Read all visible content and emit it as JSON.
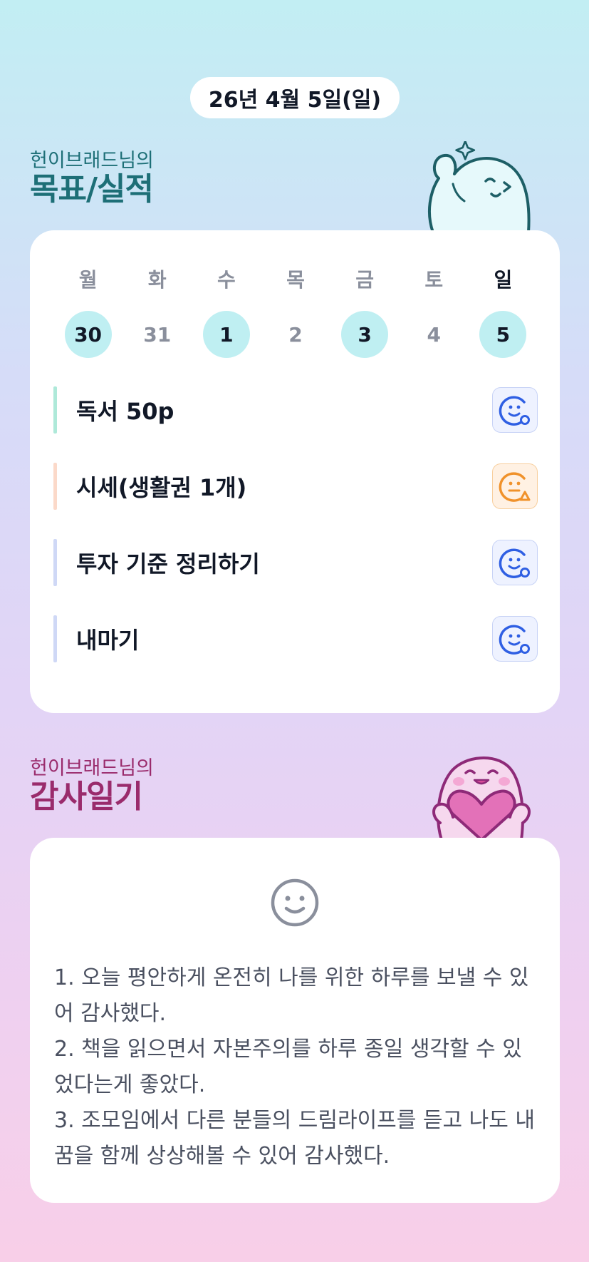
{
  "header": {
    "date": "26년 4월 5일(일)"
  },
  "goals_section": {
    "owner": "헌이브래드님의",
    "title": "목표/실적",
    "week": [
      {
        "weekday": "월",
        "day": "30",
        "done": true,
        "sunday": false
      },
      {
        "weekday": "화",
        "day": "31",
        "done": false,
        "sunday": false
      },
      {
        "weekday": "수",
        "day": "1",
        "done": true,
        "sunday": false
      },
      {
        "weekday": "목",
        "day": "2",
        "done": false,
        "sunday": false
      },
      {
        "weekday": "금",
        "day": "3",
        "done": true,
        "sunday": false
      },
      {
        "weekday": "토",
        "day": "4",
        "done": false,
        "sunday": false
      },
      {
        "weekday": "일",
        "day": "5",
        "done": true,
        "sunday": true
      }
    ],
    "goals": [
      {
        "label": "독서 50p",
        "bar_color": "#aee9d9",
        "status_icon": "smile-check-icon",
        "status_color": "#2f5fe3"
      },
      {
        "label": "시세(생활권 1개)",
        "bar_color": "#fbd9c9",
        "status_icon": "neutral-warning-icon",
        "status_color": "#f0922b"
      },
      {
        "label": "투자 기준 정리하기",
        "bar_color": "#cfd8f6",
        "status_icon": "smile-check-icon",
        "status_color": "#2f5fe3"
      },
      {
        "label": "내마기",
        "bar_color": "#cfd8f6",
        "status_icon": "smile-check-icon",
        "status_color": "#2f5fe3"
      }
    ]
  },
  "gratitude_section": {
    "owner": "헌이브래드님의",
    "title": "감사일기",
    "mood_icon": "smile-face-icon",
    "entries": [
      "1. 오늘 평안하게 온전히 나를 위한 하루를 보낼 수 있어 감사했다.",
      "2. 책을 읽으면서 자본주의를 하루 종일 생각할 수 있었다는게 좋았다.",
      "3. 조모임에서 다른 분들의 드림라이프를 듣고 나도 내 꿈을 함께 상상해볼 수 있어 감사했다."
    ]
  },
  "colors": {
    "goals_title": "#1d6f77",
    "thanks_title": "#9a2b6c",
    "done_day": "#bfeff2"
  }
}
